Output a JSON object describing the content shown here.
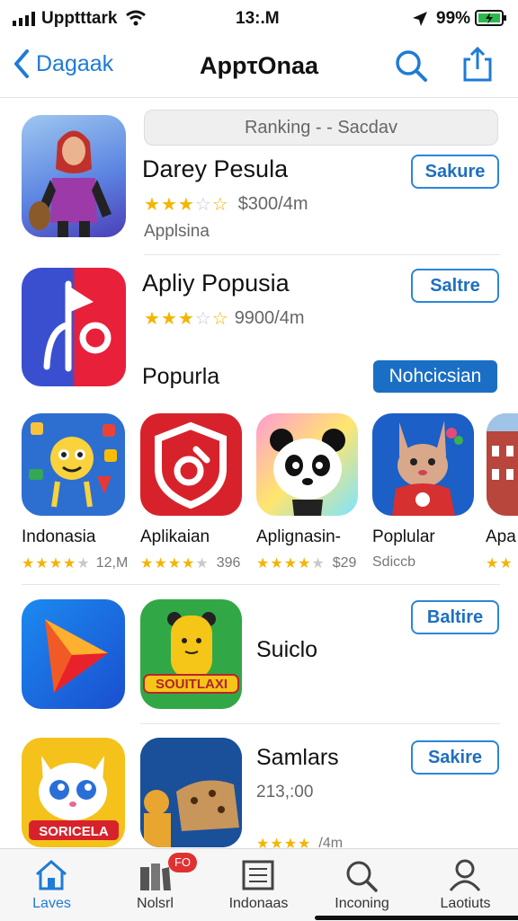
{
  "status": {
    "carrier": "Upptttark",
    "time": "13:.M",
    "battery": "99%"
  },
  "nav": {
    "back_label": "Dagaak",
    "title": "AppτOnaa"
  },
  "ranking_label": "Ranking  - -  Sacdav",
  "apps": [
    {
      "name": "Darey Pesula",
      "rating": 3,
      "meta": "$300/4m",
      "category": "Applsina",
      "action": "Sakure"
    },
    {
      "name": "Apliy Popusia",
      "rating": 3,
      "meta": "9900/4m",
      "action": "Saltre"
    }
  ],
  "section": {
    "title": "Popurla",
    "button": "Nohcicsian"
  },
  "carousel": [
    {
      "name": "Indonasia",
      "rating": 4,
      "meta": "12,M"
    },
    {
      "name": "Aplikaian",
      "rating": 4,
      "meta": "396"
    },
    {
      "name": "Aplignasin-",
      "rating": 4,
      "meta": "$29"
    },
    {
      "name": "Poplular",
      "meta": "Sdiccb"
    },
    {
      "name": "Apa",
      "rating": 2
    }
  ],
  "row3": {
    "title": "Suiclo",
    "action": "Baltire",
    "icon_text": "SOUITLAXI"
  },
  "row4": {
    "title": "Samlars",
    "meta": "213,:00",
    "action": "Sakire",
    "rating": 4,
    "rating_meta": "/4m",
    "icon_text": "SORICELA"
  },
  "tabs": [
    {
      "label": "Laves",
      "icon": "home-icon",
      "active": true
    },
    {
      "label": "Nolsrl",
      "icon": "books-icon",
      "badge": "FO"
    },
    {
      "label": "Indonaas",
      "icon": "list-icon"
    },
    {
      "label": "Inconing",
      "icon": "search-icon"
    },
    {
      "label": "Laotiuts",
      "icon": "person-icon"
    }
  ],
  "colors": {
    "accent": "#1e7bd6",
    "star": "#f4b400",
    "badge": "#e03131"
  }
}
